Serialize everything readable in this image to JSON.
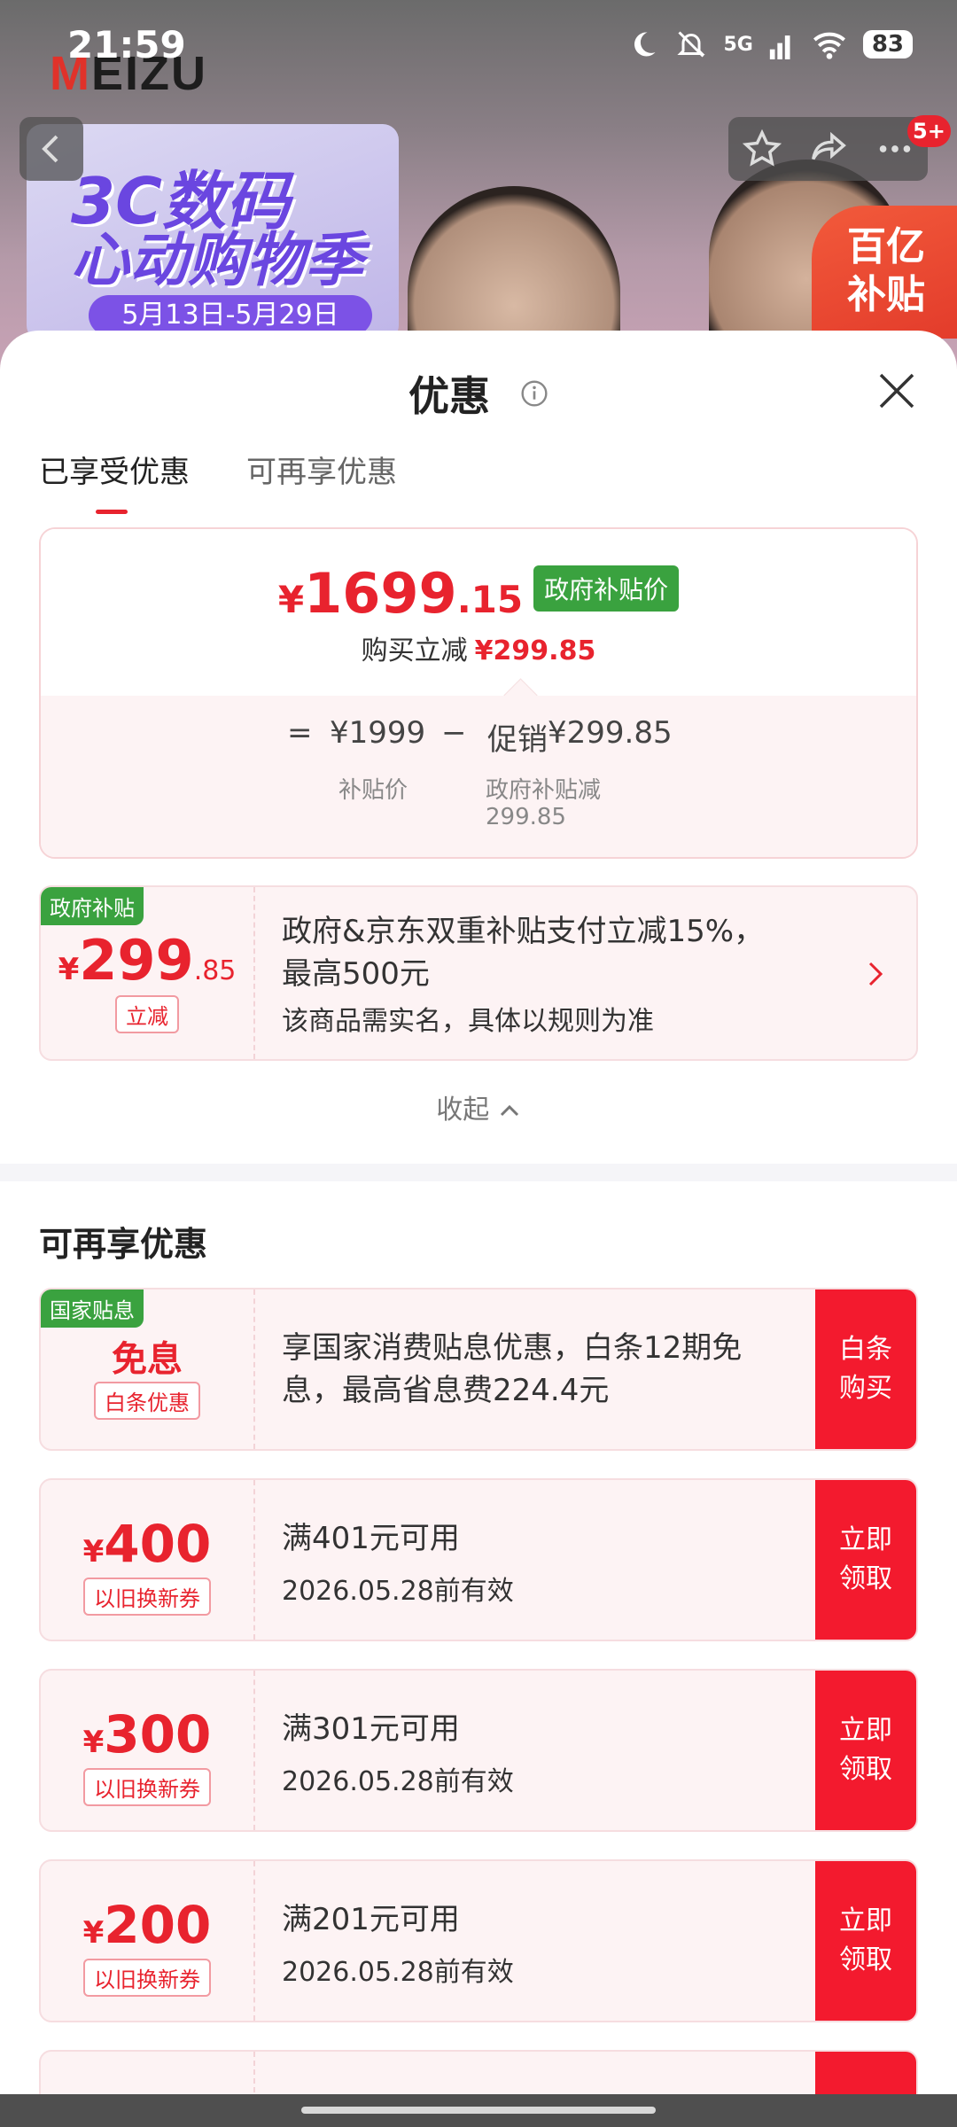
{
  "status_bar": {
    "time": "21:59",
    "network": "5G",
    "battery": "83"
  },
  "banner": {
    "brand_prefix": "M",
    "brand_rest": "EIZU",
    "promo_line1": "3C数码",
    "promo_line2": "心动购物季",
    "promo_dates": "5月13日-5月29日",
    "subsidy_badge": "百亿\n补贴",
    "notification_count": "5+"
  },
  "sheet": {
    "title": "优惠",
    "tabs": [
      {
        "label": "已享受优惠",
        "active": true
      },
      {
        "label": "可再享优惠",
        "active": false
      }
    ],
    "summary": {
      "price_symbol": "¥",
      "price_int": "1699",
      "price_dec": ".15",
      "price_tag": "政府补贴价",
      "reduce_label": "购买立减",
      "reduce_amount": "¥299.85",
      "formula_eq": "=",
      "base_price": "¥1999",
      "base_label": "补贴价",
      "minus": "−",
      "promo_label": "促销",
      "promo_amount": "¥299.85",
      "promo_sub_label": "政府补贴减",
      "promo_sub_amount": "299.85"
    },
    "gov_coupon": {
      "tag": "政府补贴",
      "symbol": "¥",
      "amount_int": "299",
      "amount_dec": ".85",
      "pill": "立减",
      "desc": "政府&京东双重补贴支付立减15%，最高500元",
      "note": "该商品需实名，具体以规则为准"
    },
    "collapse_label": "收起",
    "more_section_title": "可再享优惠",
    "more_coupons": [
      {
        "tag": "国家贴息",
        "amount": "免息",
        "pill": "白条优惠",
        "line1": "享国家消费贴息优惠，白条12期免息，最高省息费224.4元",
        "line2": "",
        "action": "白条\n购买"
      },
      {
        "tag": "",
        "symbol": "¥",
        "amount": "400",
        "pill": "以旧换新券",
        "line1": "满401元可用",
        "line2": "2026.05.28前有效",
        "action": "立即\n领取"
      },
      {
        "tag": "",
        "symbol": "¥",
        "amount": "300",
        "pill": "以旧换新券",
        "line1": "满301元可用",
        "line2": "2026.05.28前有效",
        "action": "立即\n领取"
      },
      {
        "tag": "",
        "symbol": "¥",
        "amount": "200",
        "pill": "以旧换新券",
        "line1": "满201元可用",
        "line2": "2026.05.28前有效",
        "action": "立即\n领取"
      }
    ]
  },
  "colors": {
    "accent_red": "#e8232e",
    "action_red": "#f31a2e",
    "gov_green": "#3aa23f",
    "coupon_bg": "#fdf3f4"
  }
}
